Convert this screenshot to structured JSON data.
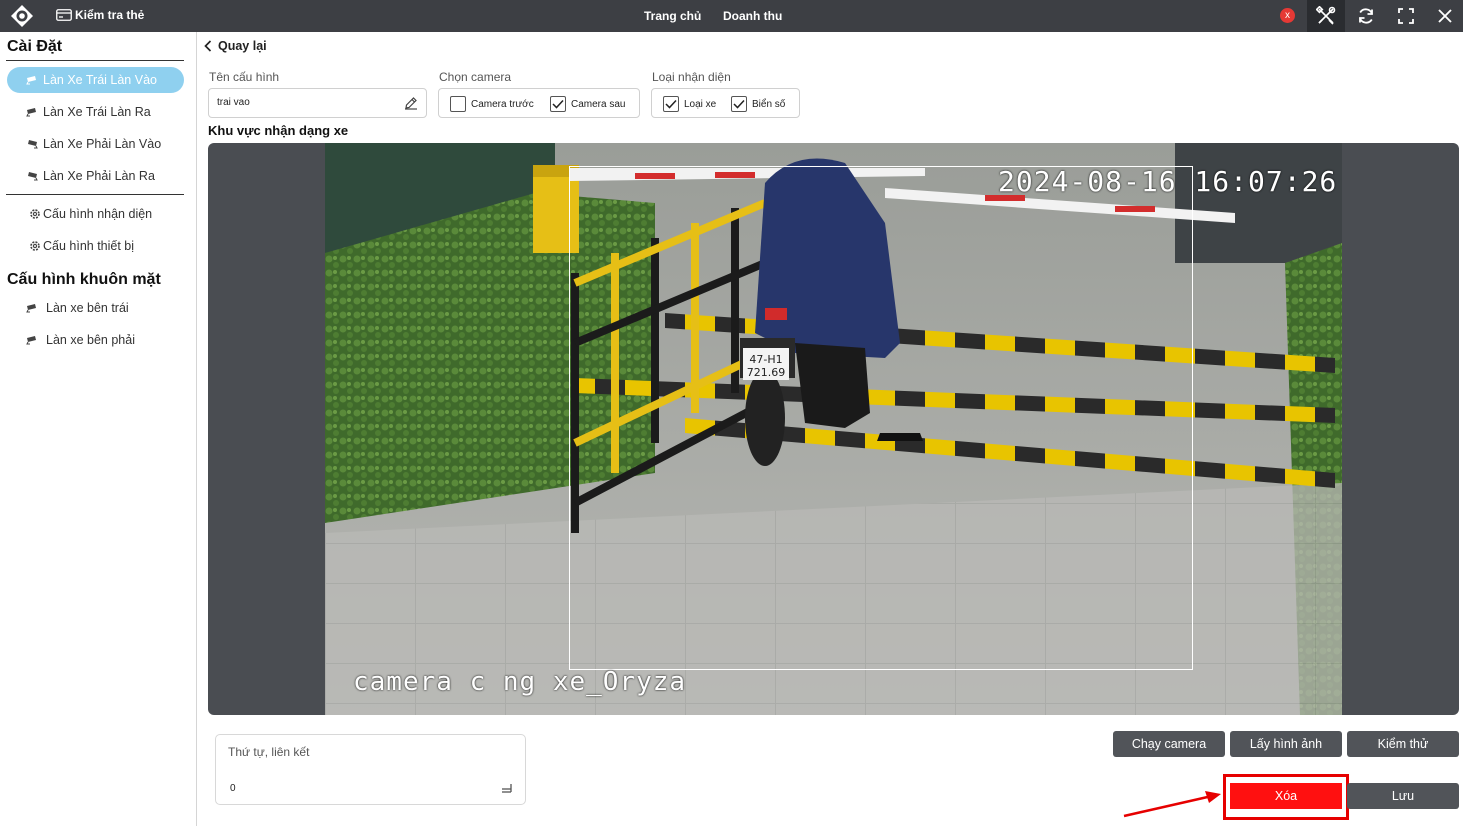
{
  "topbar": {
    "card_check_label": "Kiểm tra thẻ",
    "nav_home": "Trang chủ",
    "nav_revenue": "Doanh thu",
    "badge": "x"
  },
  "sidebar": {
    "settings_title": "Cài Đặt",
    "items": [
      {
        "label": "Làn Xe Trái Làn Vào"
      },
      {
        "label": "Làn Xe Trái Làn Ra"
      },
      {
        "label": "Làn Xe Phải Làn Vào"
      },
      {
        "label": "Làn Xe Phải Làn Ra"
      }
    ],
    "config_recognition": "Cấu hình nhận diện",
    "config_device": "Cấu hình thiết bị",
    "face_title": "Cấu hình khuôn mặt",
    "face_items": [
      {
        "label": "Làn xe bên trái"
      },
      {
        "label": "Làn xe bên phải"
      }
    ]
  },
  "form": {
    "back_label": "Quay lại",
    "config_name_label": "Tên cấu hình",
    "config_name_value": "trai vao",
    "camera_label": "Chọn camera",
    "camera_front": "Camera trước",
    "camera_rear": "Camera sau",
    "recognition_label": "Loại nhận diện",
    "type_vehicle": "Loại xe",
    "type_plate": "Biển số",
    "zone_title": "Khu vực nhận dạng xe",
    "order_label": "Thứ tự, liên kết",
    "order_value": "0"
  },
  "camera_view": {
    "timestamp": "2024-08-16 16:07:26",
    "camera_name": "camera c   ng xe_Oryza",
    "plate_line1": "47-H1",
    "plate_line2": "721.69"
  },
  "buttons": {
    "run_camera": "Chạy camera",
    "get_image": "Lấy hình ảnh",
    "test": "Kiểm thử",
    "delete": "Xóa",
    "save": "Lưu"
  },
  "checkbox_states": {
    "camera_front": false,
    "camera_rear": true,
    "type_vehicle": true,
    "type_plate": true
  },
  "colors": {
    "topbar": "#3d3f44",
    "active_item": "#8fd0ef",
    "button": "#515459",
    "delete": "#ff1010",
    "highlight": "#e60000"
  }
}
